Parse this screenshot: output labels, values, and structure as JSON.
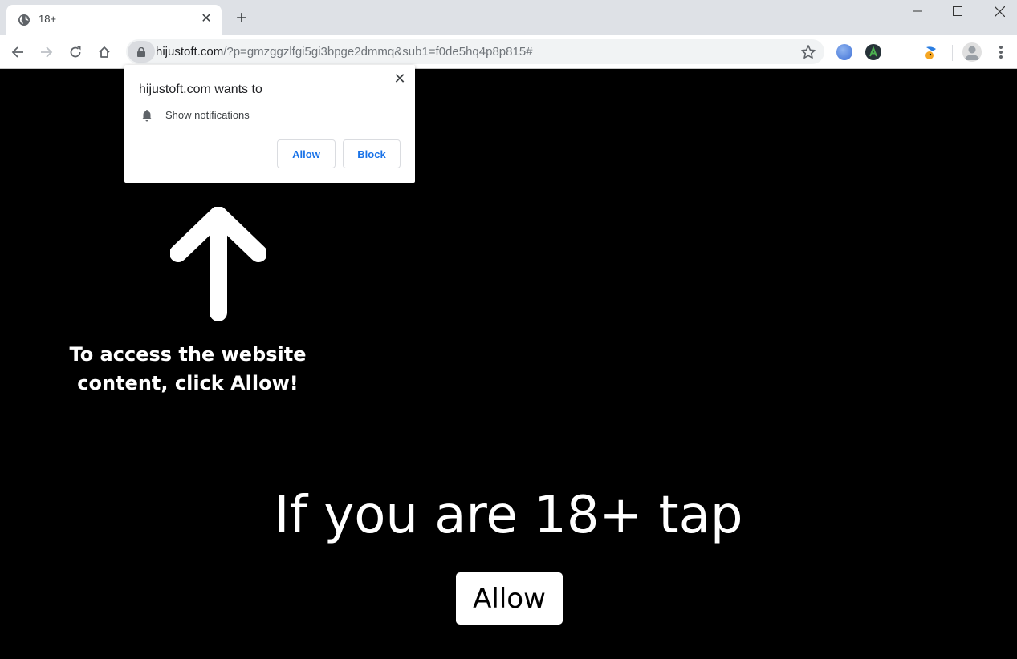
{
  "browser": {
    "tab": {
      "title": "18+",
      "favicon": "globe-icon"
    },
    "new_tab_icon": "plus-icon",
    "window_controls": [
      "minimize-icon",
      "maximize-icon",
      "close-icon"
    ],
    "nav": [
      "back-icon",
      "forward-icon",
      "reload-icon",
      "home-icon"
    ],
    "url": {
      "host": "hijustoft.com",
      "rest": "/?p=gmzggzlfgi5gi3bpge2dmmq&sub1=f0de5hq4p8p815#"
    },
    "extensions": [
      "email-extension-icon",
      "a-extension-icon",
      "bird-extension-icon"
    ]
  },
  "permission_prompt": {
    "title": "hijustoft.com wants to",
    "permission": "Show notifications",
    "allow_label": "Allow",
    "block_label": "Block",
    "colors": {
      "button_text": "#1a73e8"
    }
  },
  "page": {
    "hint_line1": "To access the website",
    "hint_line2": "content, click Allow!",
    "headline": "If you are 18+ tap",
    "allow_button": "Allow",
    "colors": {
      "background": "#000000",
      "text": "#ffffff"
    }
  }
}
